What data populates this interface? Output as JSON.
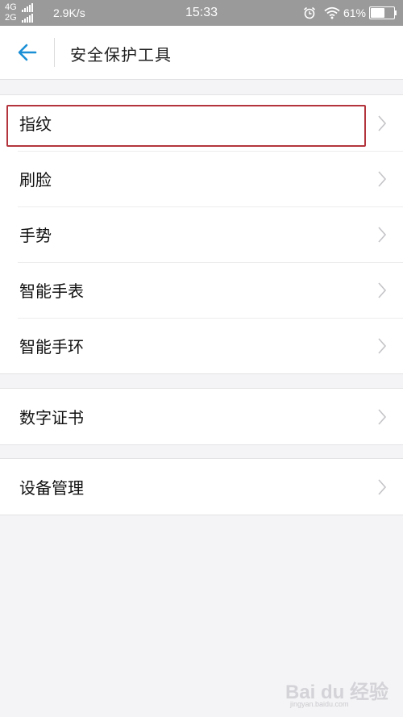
{
  "status_bar": {
    "network_primary": "4G",
    "network_secondary": "2G",
    "speed": "2.9K/s",
    "time": "15:33",
    "battery_percent": "61%",
    "battery_level": 0.61,
    "icons": [
      "signal-icon",
      "alarm-icon",
      "wifi-icon",
      "battery-icon"
    ]
  },
  "header": {
    "back_icon": "arrow-left-icon",
    "title": "安全保护工具"
  },
  "groups": [
    {
      "items": [
        {
          "label": "指纹"
        },
        {
          "label": "刷脸"
        },
        {
          "label": "手势"
        },
        {
          "label": "智能手表"
        },
        {
          "label": "智能手环"
        }
      ]
    },
    {
      "items": [
        {
          "label": "数字证书"
        }
      ]
    },
    {
      "items": [
        {
          "label": "设备管理"
        }
      ]
    }
  ],
  "watermark": {
    "brand": "Bai du 经验",
    "url": "jingyan.baidu.com"
  },
  "colors": {
    "accent": "#1a8fd6",
    "highlight": "#b3343c",
    "background": "#f4f4f6",
    "status_bar": "#9a9a9a"
  }
}
